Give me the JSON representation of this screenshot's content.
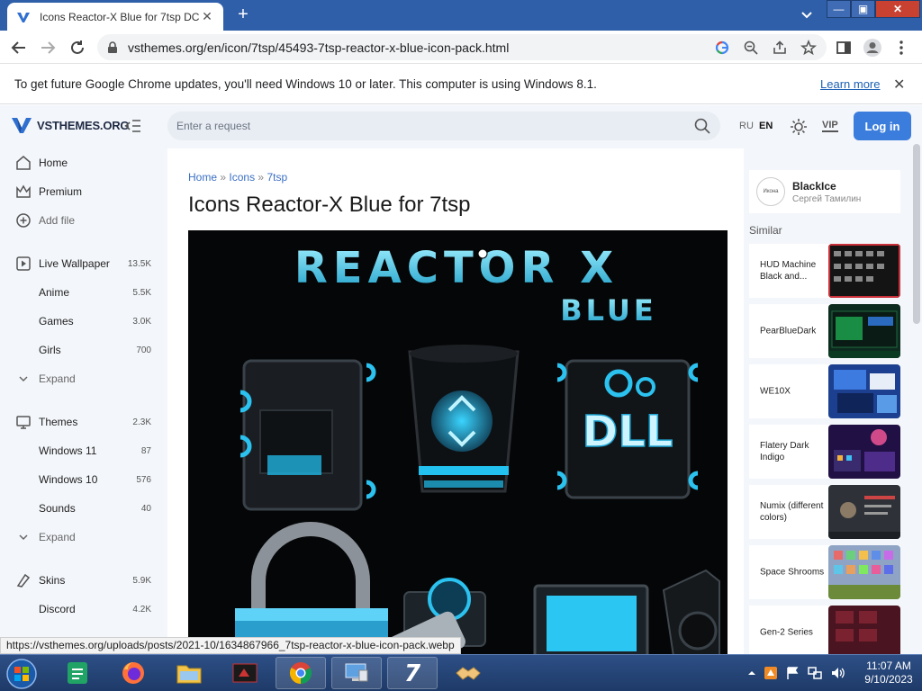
{
  "browser": {
    "tab_title": "Icons Reactor-X Blue for 7tsp DC",
    "tab_close": "✕",
    "new_tab": "+",
    "url": "vsthemes.org/en/icon/7tsp/45493-7tsp-reactor-x-blue-icon-pack.html",
    "window_min": "—",
    "window_max": "▣",
    "window_close": "✕"
  },
  "infobar": {
    "message": "To get future Google Chrome updates, you'll need Windows 10 or later. This computer is using Windows 8.1.",
    "learn_more": "Learn more",
    "close": "✕"
  },
  "site": {
    "logo_text": "VSTHEMES.ORG",
    "search_placeholder": "Enter a request",
    "lang_ru": "RU",
    "lang_en": "EN",
    "vip": "VIP",
    "login": "Log in"
  },
  "sidebar": {
    "home": "Home",
    "premium": "Premium",
    "add_file": "Add file",
    "live_wallpaper": {
      "label": "Live Wallpaper",
      "count": "13.5K"
    },
    "anime": {
      "label": "Anime",
      "count": "5.5K"
    },
    "games": {
      "label": "Games",
      "count": "3.0K"
    },
    "girls": {
      "label": "Girls",
      "count": "700"
    },
    "expand1": "Expand",
    "themes": {
      "label": "Themes",
      "count": "2.3K"
    },
    "windows11": {
      "label": "Windows 11",
      "count": "87"
    },
    "windows10": {
      "label": "Windows 10",
      "count": "576"
    },
    "sounds": {
      "label": "Sounds",
      "count": "40"
    },
    "expand2": "Expand",
    "skins": {
      "label": "Skins",
      "count": "5.9K"
    },
    "discord": {
      "label": "Discord",
      "count": "4.2K"
    }
  },
  "content": {
    "breadcrumb": {
      "home": "Home",
      "sep": "»",
      "icons": "Icons",
      "tsp": "7tsp"
    },
    "title": "Icons Reactor-X Blue for 7tsp",
    "preview": {
      "headline": "REACTOR X",
      "subline": "BLUE",
      "dll": "DLL"
    }
  },
  "author": {
    "name": "BlackIce",
    "subtitle": "Сергей Тамилин",
    "avatar_text": "Икона"
  },
  "similar": {
    "heading": "Similar",
    "items": [
      {
        "title": "HUD Machine Black and..."
      },
      {
        "title": "PearBlueDark"
      },
      {
        "title": "WE10X"
      },
      {
        "title": "Flatery Dark Indigo"
      },
      {
        "title": "Numix (different colors)"
      },
      {
        "title": "Space Shrooms"
      },
      {
        "title": "Gen-2 Series"
      }
    ]
  },
  "status_url": "https://vsthemes.org/uploads/posts/2021-10/1634867966_7tsp-reactor-x-blue-icon-pack.webp",
  "taskbar": {
    "time": "11:07 AM",
    "date": "9/10/2023"
  },
  "colors": {
    "accent": "#3b7ddd",
    "chrome_frame": "#2f5fa8",
    "glow": "#35c6f0"
  }
}
